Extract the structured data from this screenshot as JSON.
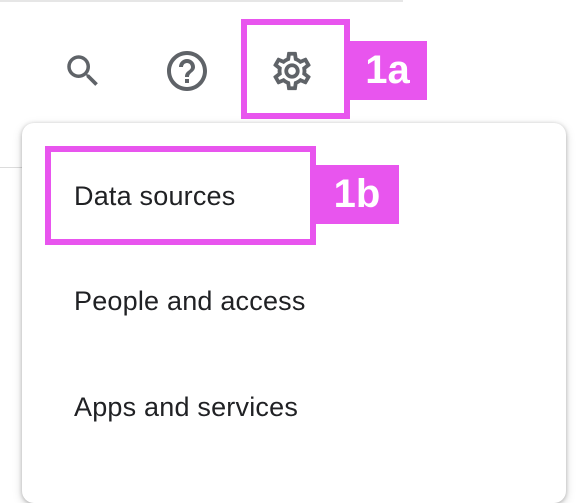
{
  "toolbar": {
    "icons": [
      "search-icon",
      "help-icon",
      "settings-icon"
    ]
  },
  "annotations": {
    "step_1a": "1a",
    "step_1b": "1b",
    "highlight_color": "#e855ee"
  },
  "settings_menu": {
    "items": [
      {
        "label": "Data sources"
      },
      {
        "label": "People and access"
      },
      {
        "label": "Apps and services"
      }
    ]
  },
  "colors": {
    "icon": "#5f6368",
    "text": "#202124"
  }
}
